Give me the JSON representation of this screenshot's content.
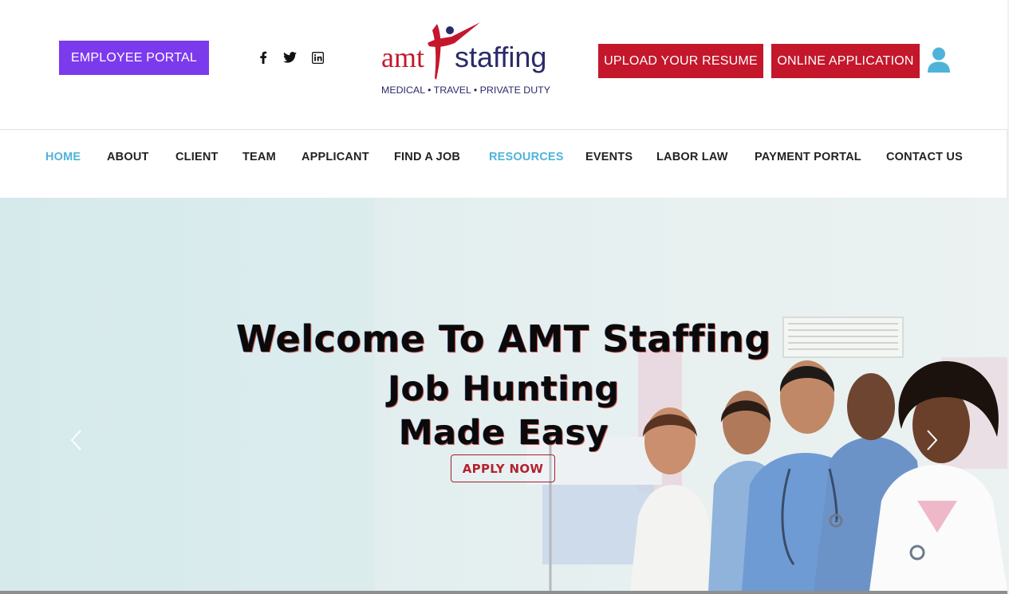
{
  "header": {
    "employee_portal": "EMPLOYEE PORTAL",
    "social_icons": [
      "facebook-icon",
      "twitter-icon",
      "linkedin-icon"
    ],
    "logo": {
      "brand_left": "amt",
      "brand_right": "staffing",
      "tagline": "MEDICAL • TRAVEL • PRIVATE DUTY"
    },
    "upload_resume": "UPLOAD YOUR RESUME",
    "online_application": "ONLINE APPLICATION",
    "account_icon": "user-icon"
  },
  "nav": {
    "items": [
      {
        "label": "HOME",
        "active": true
      },
      {
        "label": "ABOUT",
        "active": false
      },
      {
        "label": "CLIENT",
        "active": false
      },
      {
        "label": "TEAM",
        "active": false
      },
      {
        "label": "APPLICANT",
        "active": false
      },
      {
        "label": "FIND A JOB",
        "active": false
      },
      {
        "label": "RESOURCES",
        "active": true
      },
      {
        "label": "EVENTS",
        "active": false
      },
      {
        "label": "LABOR LAW",
        "active": false
      },
      {
        "label": "PAYMENT PORTAL",
        "active": false
      },
      {
        "label": "CONTACT US",
        "active": false
      }
    ]
  },
  "hero": {
    "title": "Welcome To AMT Staffing",
    "line1": "Job Hunting",
    "line2": "Made Easy",
    "cta": "APPLY NOW",
    "prev_icon": "chevron-left-icon",
    "next_icon": "chevron-right-icon"
  },
  "colors": {
    "employee_portal_bg": "#7c3aed",
    "red_button_bg": "#c4172c",
    "nav_active": "#4fb3d9",
    "logo_red": "#c4172c",
    "logo_navy": "#2a2a6a",
    "user_icon": "#4fb3d9",
    "cta_text": "#b3232f"
  }
}
